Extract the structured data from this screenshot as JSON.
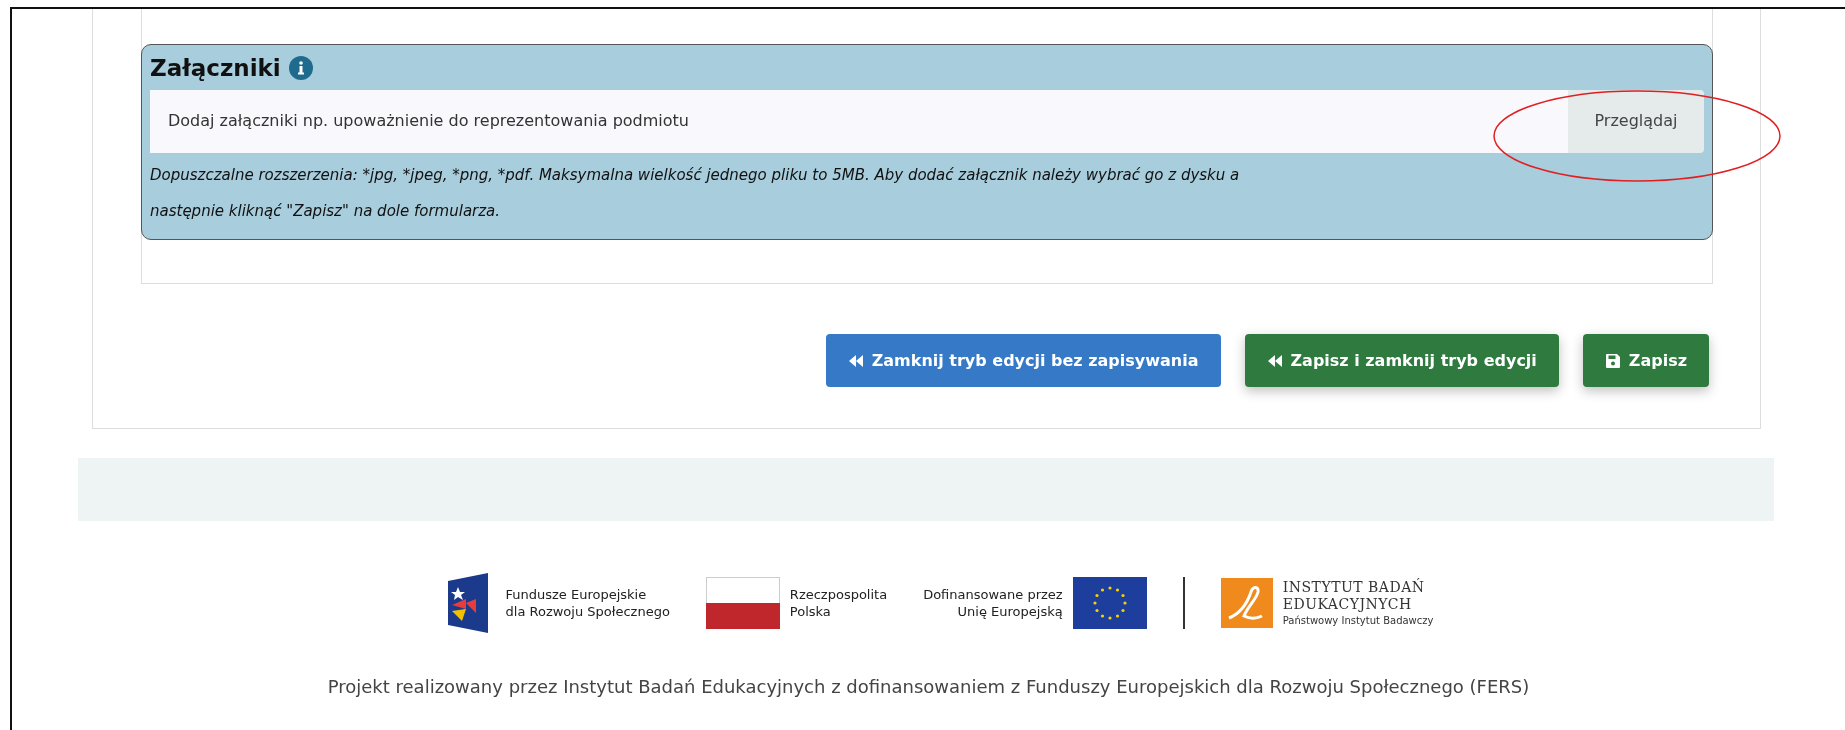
{
  "attachments": {
    "title": "Załączniki",
    "file_input": {
      "placeholder": "Dodaj załączniki np. upoważnienie do reprezentowania podmiotu",
      "button": "Przeglądaj"
    },
    "help_text": "Dopuszczalne rozszerzenia: *jpg, *jpeg, *png, *pdf. Maksymalna wielkość jednego pliku to 5MB. Aby dodać załącznik należy wybrać go z dysku a następnie kliknąć \"Zapisz\" na dole formularza."
  },
  "buttons": [
    {
      "label": "Zamknij tryb edycji bez zapisywania",
      "kind": "cancel"
    },
    {
      "label": "Zapisz i zamknij tryb edycji",
      "kind": "save-close"
    },
    {
      "label": "Zapisz",
      "kind": "save"
    }
  ],
  "logos": [
    {
      "kind": "fers",
      "lines": [
        "Fundusze Europejskie",
        "dla Rozwoju Społecznego"
      ]
    },
    {
      "kind": "pl",
      "lines": [
        "Rzeczpospolita",
        "Polska"
      ]
    },
    {
      "kind": "eu",
      "lines": [
        "Dofinansowane przez",
        "Unię Europejską"
      ]
    },
    {
      "kind": "ibe",
      "lines": [
        "INSTYTUT BADAŃ",
        "EDUKACYJNYCH"
      ],
      "subtitle": "Państwowy Instytut Badawczy"
    }
  ],
  "footer": "Projekt realizowany przez Instytut Badań Edukacyjnych z dofinansowaniem z Funduszy Europejskich dla Rozwoju Społecznego (FERS)"
}
